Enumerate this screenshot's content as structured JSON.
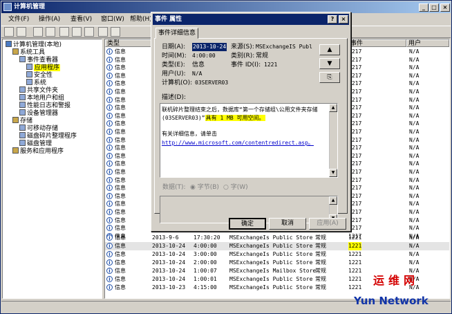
{
  "window": {
    "title": "计算机管理"
  },
  "menu": [
    "文件(F)",
    "操作(A)",
    "查看(V)",
    "窗口(W)",
    "帮助(H)"
  ],
  "tree": [
    {
      "label": "计算机管理(本地)",
      "indent": 0
    },
    {
      "label": "系统工具",
      "indent": 1
    },
    {
      "label": "事件查看器",
      "indent": 2
    },
    {
      "label": "应用程序",
      "indent": 3,
      "selected": true
    },
    {
      "label": "安全性",
      "indent": 3
    },
    {
      "label": "系统",
      "indent": 3
    },
    {
      "label": "共享文件夹",
      "indent": 2
    },
    {
      "label": "本地用户和组",
      "indent": 2
    },
    {
      "label": "性能日志和警报",
      "indent": 2
    },
    {
      "label": "设备管理器",
      "indent": 2
    },
    {
      "label": "存储",
      "indent": 1
    },
    {
      "label": "可移动存储",
      "indent": 2
    },
    {
      "label": "磁盘碎片整理程序",
      "indent": 2
    },
    {
      "label": "磁盘管理",
      "indent": 2
    },
    {
      "label": "服务和应用程序",
      "indent": 1
    }
  ],
  "list": {
    "columns": {
      "type": "类型",
      "event": "事件",
      "user": "用户"
    },
    "upper_rows_count": 24,
    "upper_row": {
      "type": "信息",
      "event": "1217",
      "user": "N/A"
    },
    "rows": [
      {
        "type": "信息",
        "date": "2013-9-6",
        "time": "17:30:20",
        "source": "MSExchangeIs Public Store",
        "category": "常规",
        "event": "1221",
        "user": "N/A"
      },
      {
        "type": "信息",
        "date": "2013-10-24",
        "time": "4:00:00",
        "source": "MSExchangeIs Public Store",
        "category": "常规",
        "event": "1221",
        "user": "N/A",
        "selected": true
      },
      {
        "type": "信息",
        "date": "2013-10-24",
        "time": "3:00:00",
        "source": "MSExchangeIs Public Store",
        "category": "常规",
        "event": "1221",
        "user": "N/A"
      },
      {
        "type": "信息",
        "date": "2013-10-24",
        "time": "2:00:00",
        "source": "MSExchangeIs Public Store",
        "category": "常规",
        "event": "1221",
        "user": "N/A"
      },
      {
        "type": "信息",
        "date": "2013-10-24",
        "time": "1:00:07",
        "source": "MSExchangeIs Mailbox Store",
        "category": "常规",
        "event": "1221",
        "user": "N/A"
      },
      {
        "type": "信息",
        "date": "2013-10-24",
        "time": "1:00:01",
        "source": "MSExchangeIs Public Store",
        "category": "常规",
        "event": "1221",
        "user": "N/A"
      },
      {
        "type": "信息",
        "date": "2013-10-23",
        "time": "4:15:00",
        "source": "MSExchangeIs Public Store",
        "category": "常规",
        "event": "1221",
        "user": "N/A"
      }
    ]
  },
  "dialog": {
    "title": "事件 属性",
    "tab": "事件详细信息",
    "date_label": "日期(A):",
    "date_value": "2013-10-24",
    "source_label": "来源(S):",
    "source_value": "MSExchangeIS Publ",
    "time_label": "时间(M):",
    "time_value": "4:00:00",
    "category_label": "类别(R):",
    "category_value": "常规",
    "type_label": "类型(E):",
    "type_value": "信息",
    "eventid_label": "事件 ID(I):",
    "eventid_value": "1221",
    "user_label": "用户(U):",
    "user_value": "N/A",
    "computer_label": "计算机(O):",
    "computer_value": "03SERVER03",
    "desc_label": "描述(D):",
    "desc_line1": "联机碎片整理结束之后，数据库“第一个存储组\\公用文件夹存储",
    "desc_line2a": "(03SERVER03)”",
    "desc_line2b": "具有 1 MB 可用空间。",
    "desc_more": "有关详细信息，请单击",
    "desc_link": "http://www.microsoft.com/contentredirect.asp。",
    "data_label": "数据(T):",
    "bytes_label": "字节(B)",
    "words_label": "字(W)",
    "ok": "确定",
    "cancel": "取消",
    "apply": "应用(A)"
  },
  "watermark": {
    "cn": "运维网",
    "en": "Yun Network"
  }
}
